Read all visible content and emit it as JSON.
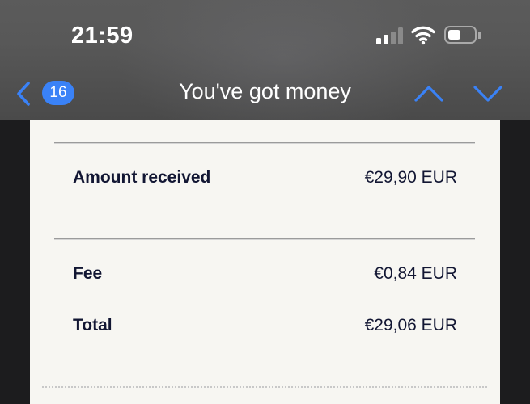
{
  "status_bar": {
    "time": "21:59",
    "battery_level": 0.5
  },
  "nav": {
    "back_badge": "16",
    "title": "You've got money"
  },
  "receipt": {
    "rows": [
      {
        "label": "Amount received",
        "value": "€29,90 EUR"
      },
      {
        "label": "Fee",
        "value": "€0,84 EUR"
      },
      {
        "label": "Total",
        "value": "€29,06 EUR"
      }
    ]
  },
  "colors": {
    "accent": "#3a82f7",
    "text_dark": "#121633",
    "receipt_bg": "#f7f6f2"
  },
  "icons": {
    "back": "chevron-left-icon",
    "previous": "chevron-up-icon",
    "next": "chevron-down-icon",
    "signal": "cellular-signal-icon",
    "wifi": "wifi-icon",
    "battery": "battery-icon"
  }
}
